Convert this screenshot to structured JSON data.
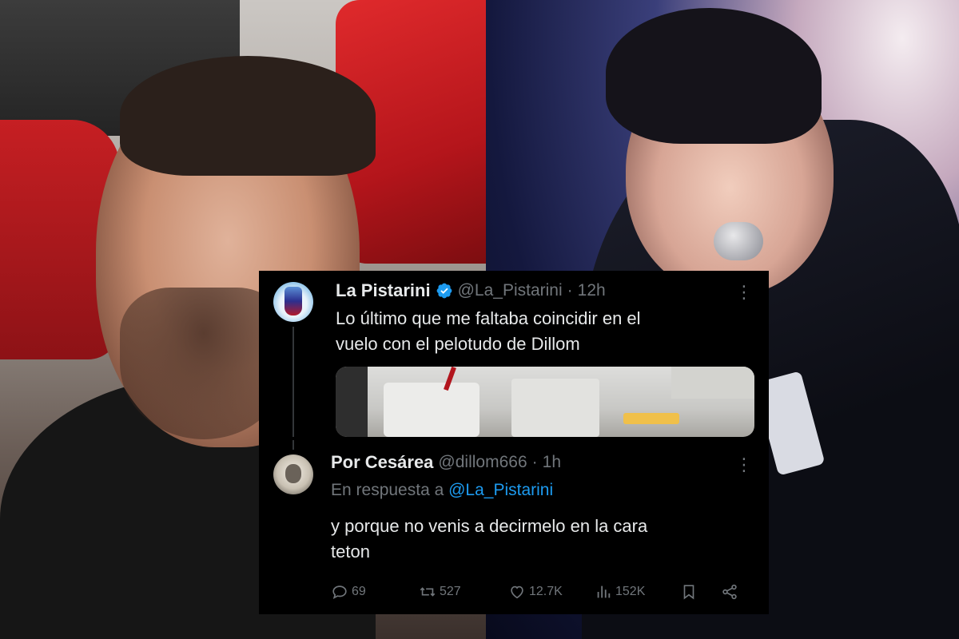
{
  "tweet1": {
    "display_name": "La Pistarini",
    "handle": "@La_Pistarini",
    "separator": "·",
    "time": "12h",
    "text_line1": "Lo último que me faltaba coincidir en el",
    "text_line2": "vuelo con el pelotudo de Dillom",
    "verified": true,
    "more_icon": "more-vertical-icon"
  },
  "tweet2": {
    "display_name": "Por Cesárea",
    "handle": "@dillom666",
    "separator": "·",
    "time": "1h",
    "reply_prefix": "En respuesta a",
    "reply_handle": "@La_Pistarini",
    "text_line1": "y porque no venis a decirmelo en la cara",
    "text_line2": "teton",
    "more_icon": "more-vertical-icon",
    "stats": {
      "replies": "69",
      "retweets": "527",
      "likes": "12.7K",
      "views": "152K"
    }
  },
  "colors": {
    "card_bg": "#000000",
    "text_primary": "#e7e9ea",
    "text_secondary": "#71767b",
    "link_blue": "#1d9bf0",
    "verified_blue": "#1d9bf0"
  }
}
